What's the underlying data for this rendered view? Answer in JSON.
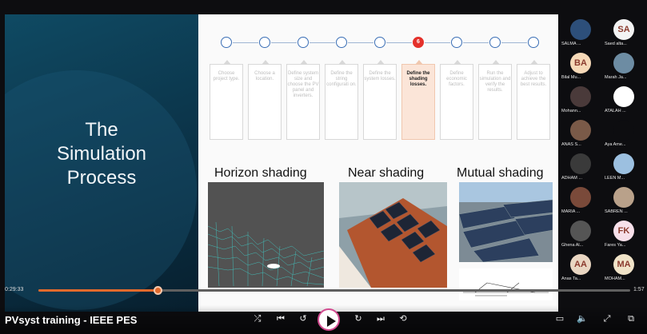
{
  "slide": {
    "title_lines": [
      "The",
      "Simulation",
      "Process"
    ],
    "active_step": "6",
    "steps": [
      "Choose project type.",
      "Choose a location.",
      "Define system size and choose the PV panel and inverters.",
      "Define the string configurati on.",
      "Define the system losses.",
      "Define the shading losses.",
      "Define economic factors.",
      "Run the simulation and verify the results.",
      "Adjust to achieve the best results."
    ],
    "shading": {
      "horizon": "Horizon shading",
      "near": "Near shading",
      "mutual": "Mutual shading"
    }
  },
  "participants": [
    {
      "initials": "",
      "name": "SALMA ...",
      "color": "#2d4f7a"
    },
    {
      "initials": "SA",
      "name": "Saed alta...",
      "color": "#f3f3f3"
    },
    {
      "initials": "BA",
      "name": "Bilal Mu...",
      "color": "#f6d9b8"
    },
    {
      "initials": "",
      "name": "Marah Ja...",
      "color": "#6d8ca3"
    },
    {
      "initials": "",
      "name": "Mohann...",
      "color": "#4a3a3a"
    },
    {
      "initials": "",
      "name": "ATALAH ...",
      "color": "#ffffff"
    },
    {
      "initials": "",
      "name": "ANAS S...",
      "color": "#7a5a48"
    },
    {
      "initials": "",
      "name": "Aya Ame...",
      "color": "#0d0d10"
    },
    {
      "initials": "",
      "name": "ADHAM ...",
      "color": "#3a3a3a"
    },
    {
      "initials": "",
      "name": "LEEN M...",
      "color": "#9cc0e0"
    },
    {
      "initials": "",
      "name": "MARIA ...",
      "color": "#7a4a3a"
    },
    {
      "initials": "",
      "name": "SABREN ...",
      "color": "#b9a18a"
    },
    {
      "initials": "",
      "name": "Ghena Al...",
      "color": "#555"
    },
    {
      "initials": "FK",
      "name": "Fares Ya...",
      "color": "#f7e0ea"
    },
    {
      "initials": "AA",
      "name": "Anas Ta...",
      "color": "#e9d6c2"
    },
    {
      "initials": "MA",
      "name": "MOHAM...",
      "color": "#f0e3c8"
    }
  ],
  "player": {
    "current_time": "0:29:33",
    "end_time": "1:57",
    "progress": 0.202,
    "title": "PVsyst training - IEEE PES",
    "icons": [
      "shuffle-icon",
      "previous-icon",
      "rewind-10-icon",
      "play-icon",
      "forward-30-icon",
      "next-icon",
      "repeat-off-icon",
      "captions-icon",
      "volume-icon",
      "fullscreen-icon",
      "picture-in-picture-icon"
    ]
  }
}
